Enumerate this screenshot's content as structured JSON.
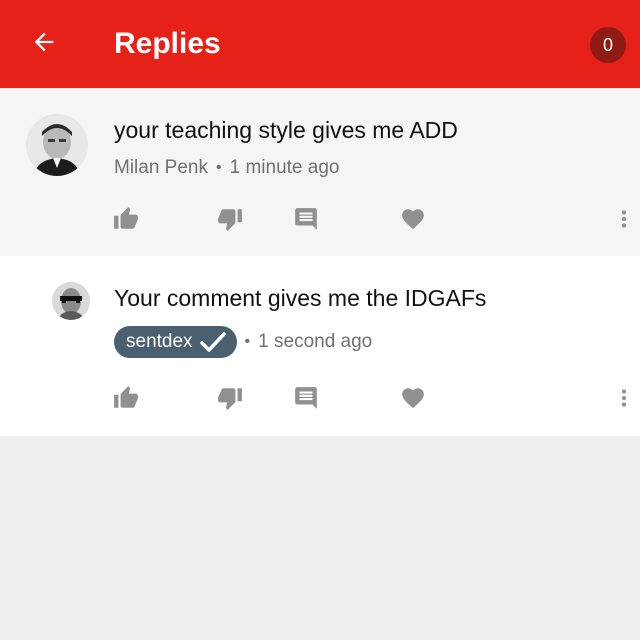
{
  "appbar": {
    "title": "Replies",
    "notification_count": "0",
    "color": "#e62117"
  },
  "comments": [
    {
      "text": "your teaching style gives me ADD",
      "author": "Milan Penk",
      "separator": "•",
      "time": "1 minute ago",
      "author_verified": false
    },
    {
      "text": "Your comment gives me the IDGAFs",
      "author": "sentdex",
      "separator": "•",
      "time": "1 second ago",
      "author_verified": true,
      "author_pill_color": "#4a6070"
    }
  ],
  "icons": {
    "back": "arrow-back-icon",
    "like": "thumb-up-icon",
    "dislike": "thumb-down-icon",
    "reply": "comment-icon",
    "heart": "heart-icon",
    "more": "more-vert-icon"
  }
}
